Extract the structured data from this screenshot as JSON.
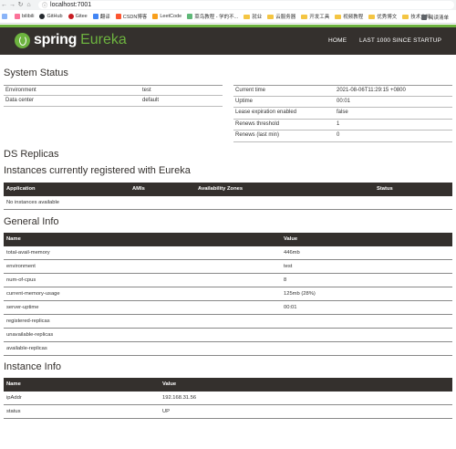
{
  "browser": {
    "url": "localhost:7001",
    "bookmarks": [
      {
        "label": "bilibili",
        "color": "#fb7299"
      },
      {
        "label": "GitHub",
        "color": "#24292e"
      },
      {
        "label": "Gitee",
        "color": "#c71d23"
      },
      {
        "label": "翻译",
        "color": "#4285f4"
      },
      {
        "label": "CSDN博客",
        "color": "#fc5531"
      },
      {
        "label": "LeetCode",
        "color": "#333333"
      },
      {
        "label": "菜鸟教程 - 学的不...",
        "color": "#5fb878"
      }
    ],
    "folders": [
      "就业",
      "云服务器",
      "开发工具",
      "视频教程",
      "优秀博文",
      "技术文档"
    ],
    "reading_list": "阅读清单"
  },
  "header": {
    "logo_spring": "spring",
    "logo_eureka": "Eureka",
    "nav_home": "HOME",
    "nav_last1000": "LAST 1000 SINCE STARTUP"
  },
  "system_status": {
    "title": "System Status",
    "left": [
      {
        "key": "Environment",
        "value": "test"
      },
      {
        "key": "Data center",
        "value": "default"
      }
    ],
    "right": [
      {
        "key": "Current time",
        "value": "2021-08-06T11:29:15 +0800"
      },
      {
        "key": "Uptime",
        "value": "00:01"
      },
      {
        "key": "Lease expiration enabled",
        "value": "false"
      },
      {
        "key": "Renews threshold",
        "value": "1"
      },
      {
        "key": "Renews (last min)",
        "value": "0"
      }
    ]
  },
  "ds_replicas": {
    "title": "DS Replicas"
  },
  "instances": {
    "title": "Instances currently registered with Eureka",
    "columns": [
      "Application",
      "AMIs",
      "Availability Zones",
      "Status"
    ],
    "empty_text": "No instances available"
  },
  "general_info": {
    "title": "General Info",
    "columns": [
      "Name",
      "Value"
    ],
    "rows": [
      {
        "name": "total-avail-memory",
        "value": "446mb"
      },
      {
        "name": "environment",
        "value": "test"
      },
      {
        "name": "num-of-cpus",
        "value": "8"
      },
      {
        "name": "current-memory-usage",
        "value": "125mb (28%)"
      },
      {
        "name": "server-uptime",
        "value": "00:01"
      },
      {
        "name": "registered-replicas",
        "value": ""
      },
      {
        "name": "unavailable-replicas",
        "value": ""
      },
      {
        "name": "available-replicas",
        "value": ""
      }
    ]
  },
  "instance_info": {
    "title": "Instance Info",
    "columns": [
      "Name",
      "Value"
    ],
    "rows": [
      {
        "name": "ipAddr",
        "value": "192.168.31.56"
      },
      {
        "name": "status",
        "value": "UP"
      }
    ]
  }
}
